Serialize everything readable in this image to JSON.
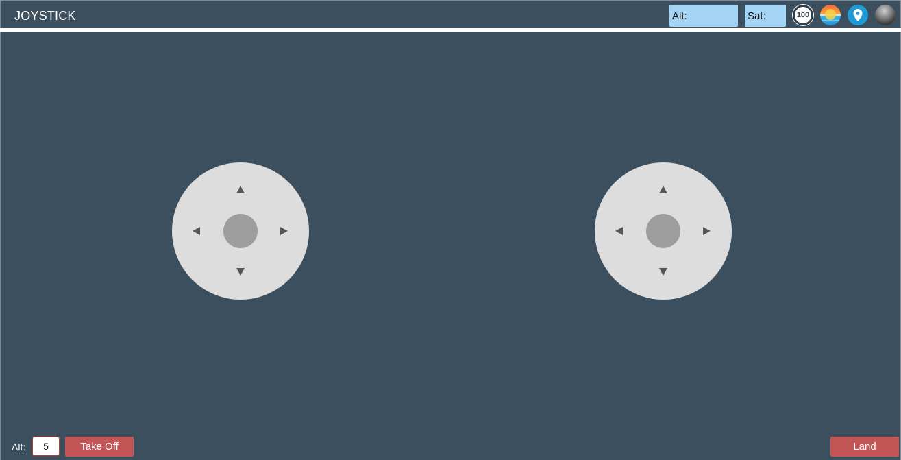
{
  "header": {
    "title": "JOYSTICK",
    "alt_label": "Alt:",
    "sat_label": "Sat:",
    "battery_value": "100",
    "icons": [
      "battery-icon",
      "weather-icon",
      "location-icon",
      "connection-icon"
    ]
  },
  "joysticks": {
    "left": {
      "up": "▲",
      "down": "▼",
      "left": "◀",
      "right": "▶"
    },
    "right": {
      "up": "▲",
      "down": "▼",
      "left": "◀",
      "right": "▶"
    }
  },
  "controls": {
    "alt_label": "Alt:",
    "alt_value": "5",
    "takeoff_label": "Take Off",
    "land_label": "Land"
  },
  "colors": {
    "background": "#3c4f5e",
    "status_box": "#a3d4f5",
    "button": "#c25555",
    "joystick_pad": "#dddddd",
    "joystick_knob": "#9d9d9d"
  }
}
